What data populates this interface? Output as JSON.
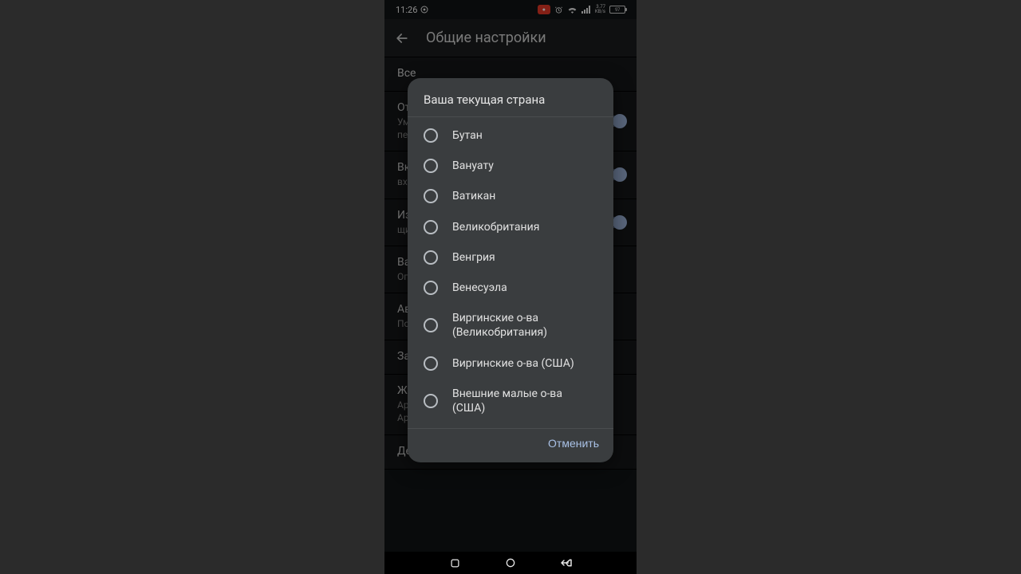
{
  "statusbar": {
    "time": "11:26",
    "network_label": "3.77\nKB/s",
    "battery_pct": "97"
  },
  "appbar": {
    "title": "Общие настройки"
  },
  "settings": [
    {
      "primary": "Все",
      "secondary": ""
    },
    {
      "primary": "От…",
      "secondary": "Ум…\nпе…",
      "toggle": true
    },
    {
      "primary": "Вк…",
      "secondary": "вх…",
      "toggle": true
    },
    {
      "primary": "Из…",
      "secondary": "щи…",
      "toggle": true
    },
    {
      "primary": "Ва…",
      "secondary": "Ог…"
    },
    {
      "primary": "Ав…",
      "secondary": "По…"
    },
    {
      "primary": "За…",
      "secondary": ""
    },
    {
      "primary": "Же…",
      "secondary": "Ар…\nАрхивировать: провести влево"
    },
    {
      "primary": "Детали и условия",
      "secondary": ""
    }
  ],
  "dialog": {
    "title": "Ваша текущая страна",
    "options": [
      "Бутан",
      "Вануату",
      "Ватикан",
      "Великобритания",
      "Венгрия",
      "Венесуэла",
      "Виргинские о-ва (Великобритания)",
      "Виргинские о-ва (США)",
      "Внешние малые о-ва (США)"
    ],
    "cancel": "Отменить"
  }
}
